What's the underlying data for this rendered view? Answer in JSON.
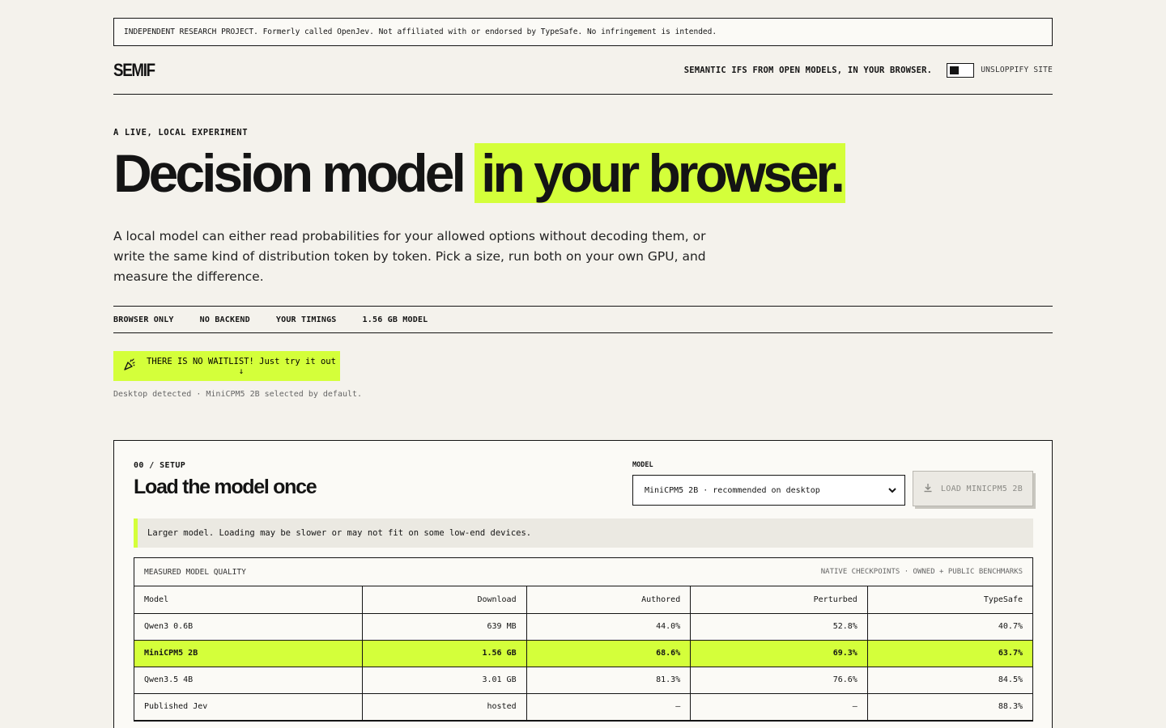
{
  "disclaimer": "INDEPENDENT RESEARCH PROJECT. Formerly called OpenJev. Not affiliated with or endorsed by TypeSafe. No infringement is intended.",
  "header": {
    "logo": "SEMIF",
    "tagline": "SEMANTIC IFS FROM OPEN MODELS, IN YOUR BROWSER.",
    "toggle_label": "UNSLOPPIFY SITE"
  },
  "hero": {
    "eyebrow": "A LIVE, LOCAL EXPERIMENT",
    "headline_plain": "Decision model",
    "headline_highlight": "in your browser.",
    "lede": "A local model can either read probabilities for your allowed options without decoding them, or write the same kind of distribution token by token. Pick a size, run both on your own GPU, and measure the difference."
  },
  "strip": [
    "BROWSER ONLY",
    "NO BACKEND",
    "YOUR TIMINGS",
    "1.56 GB MODEL"
  ],
  "cta": {
    "icon": "party-popper-icon",
    "label": "THERE IS NO WAITLIST! Just try it out ↓"
  },
  "detect_note": "Desktop detected · MiniCPM5 2B selected by default.",
  "setup": {
    "step": "00 / SETUP",
    "title": "Load the model once",
    "model_label": "MODEL",
    "model_selected": "MiniCPM5 2B · recommended on desktop",
    "load_button": "LOAD MINICPM5 2B",
    "notice": "Larger model. Loading may be slower or may not fit on some low-end devices."
  },
  "quality": {
    "title": "MEASURED MODEL QUALITY",
    "subtitle": "NATIVE CHECKPOINTS · OWNED + PUBLIC BENCHMARKS",
    "columns": [
      "Model",
      "Download",
      "Authored",
      "Perturbed",
      "TypeSafe"
    ],
    "rows": [
      [
        "Qwen3 0.6B",
        "639 MB",
        "44.0%",
        "52.8%",
        "40.7%"
      ],
      [
        "MiniCPM5 2B",
        "1.56 GB",
        "68.6%",
        "69.3%",
        "63.7%"
      ],
      [
        "Qwen3.5 4B",
        "3.01 GB",
        "81.3%",
        "76.6%",
        "84.5%"
      ],
      [
        "Published Jev",
        "hosted",
        "–",
        "–",
        "88.3%"
      ]
    ],
    "selected_row": 1
  },
  "colors": {
    "accent": "#d4ff3a",
    "background": "#f4f2ec",
    "ink": "#141414"
  }
}
